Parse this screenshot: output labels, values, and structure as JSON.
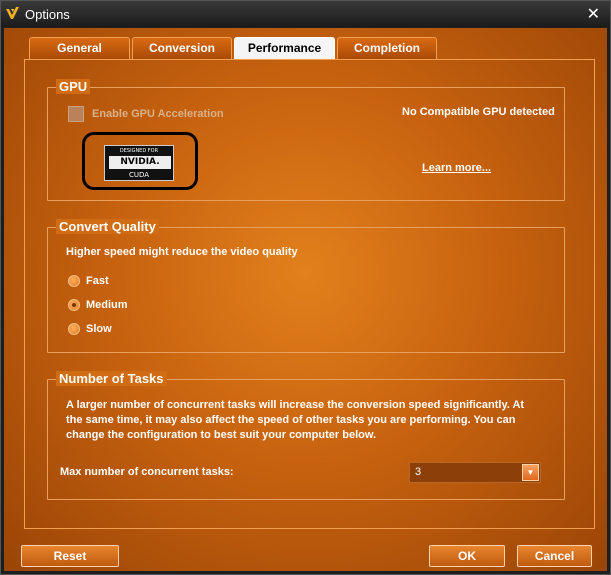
{
  "window": {
    "title": "Options"
  },
  "tabs": [
    {
      "label": "General"
    },
    {
      "label": "Conversion"
    },
    {
      "label": "Performance"
    },
    {
      "label": "Completion"
    }
  ],
  "active_tab": "Performance",
  "gpu": {
    "title": "GPU",
    "enable_label": "Enable GPU Acceleration",
    "enable_checked": false,
    "enable_disabled": true,
    "status": "No Compatible GPU detected",
    "logo": {
      "line1": "DESIGNED FOR",
      "line2": "NVIDIA.",
      "line3": "CUDA"
    },
    "learn_more": "Learn more..."
  },
  "quality": {
    "title": "Convert Quality",
    "hint": "Higher speed might reduce the video quality",
    "options": [
      {
        "label": "Fast",
        "checked": false
      },
      {
        "label": "Medium",
        "checked": true
      },
      {
        "label": "Slow",
        "checked": false
      }
    ]
  },
  "tasks": {
    "title": "Number of Tasks",
    "description_lines": [
      "A larger number of concurrent tasks will increase the conversion speed significantly. At",
      "the same time, it may also affect the speed of other tasks you are performing. You can",
      "change the configuration to best suit your computer below."
    ],
    "max_label": "Max number of concurrent tasks:",
    "max_value": "3"
  },
  "buttons": {
    "reset": "Reset",
    "ok": "OK",
    "cancel": "Cancel"
  },
  "colors": {
    "accent": "#d06c14",
    "active_tab_bg": "#f5f5f5"
  }
}
